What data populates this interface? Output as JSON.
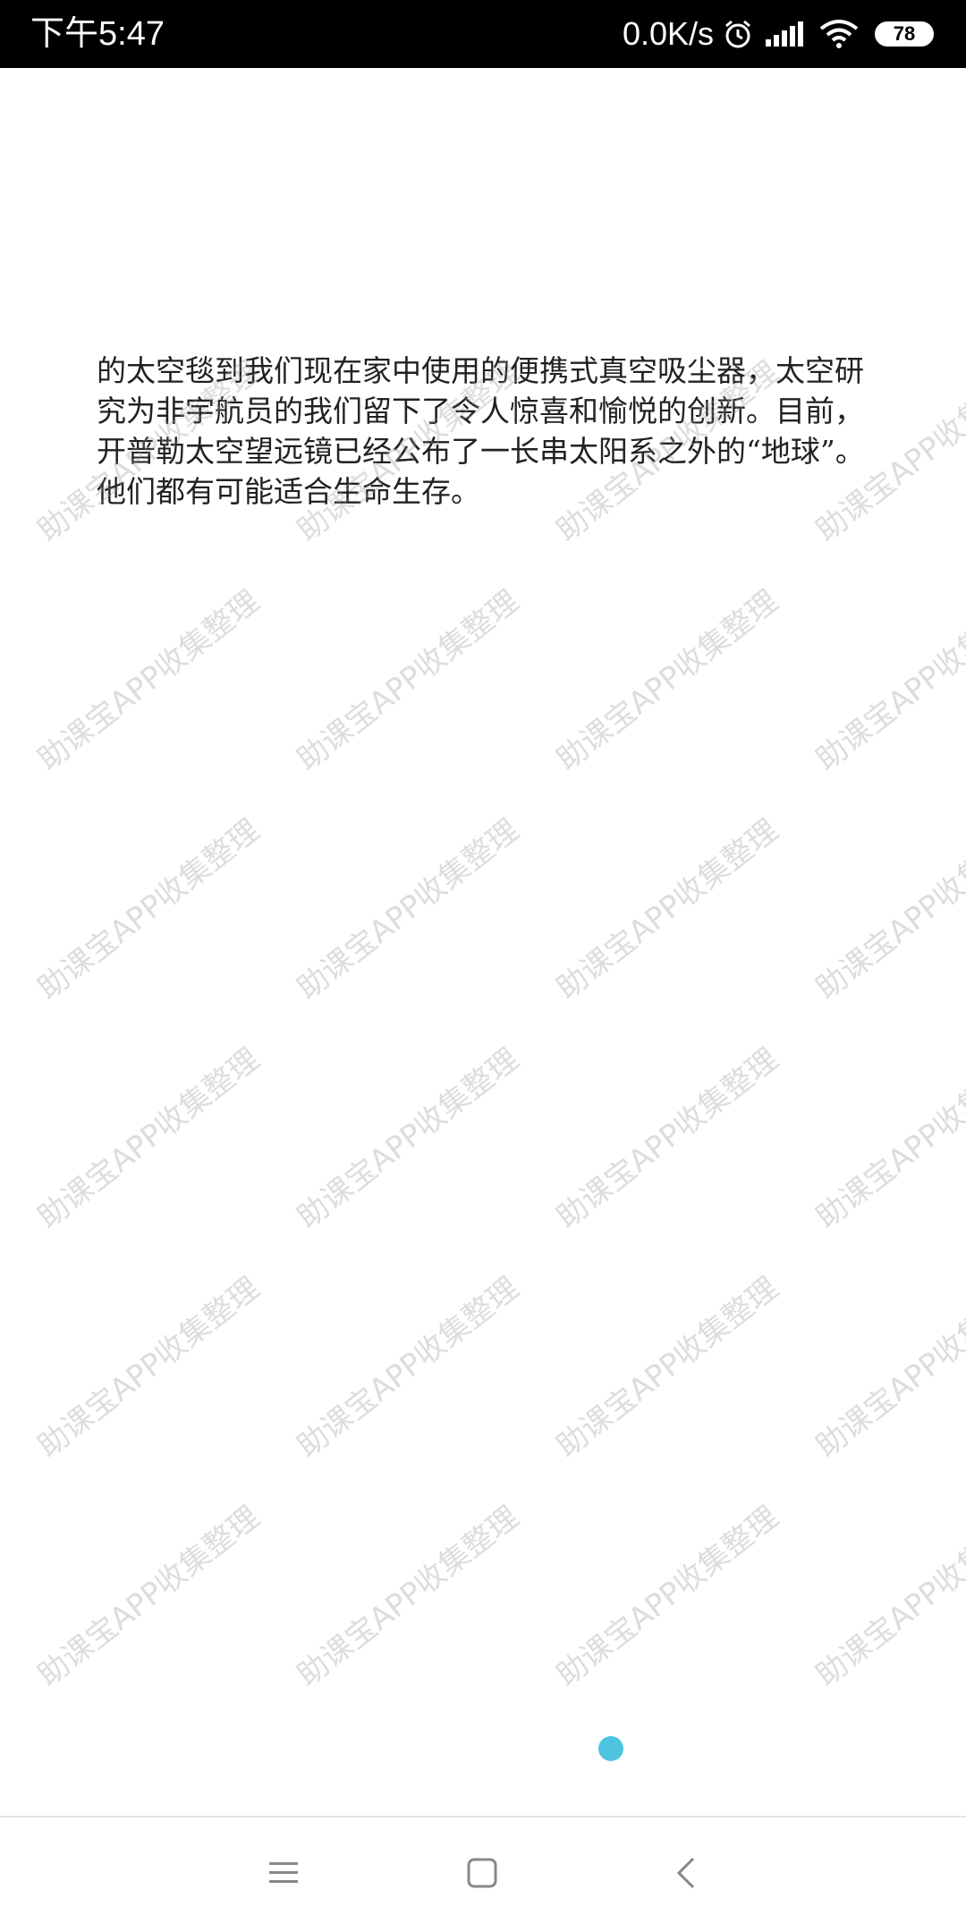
{
  "status_bar": {
    "time": "下午5:47",
    "net_speed": "0.0K/s",
    "battery": "78",
    "icons": [
      "alarm-icon",
      "signal-icon",
      "wifi-icon",
      "battery-icon"
    ]
  },
  "content": {
    "paragraph": "的太空毯到我们现在家中使用的便携式真空吸尘器，太空研究为非宇航员的我们留下了令人惊喜和愉悦的创新。目前，开普勒太空望远镜已经公布了一长串太阳系之外的“地球”。他们都有可能适合生命生存。",
    "watermark": "助课宝APP收集整理"
  },
  "pager": {
    "active_color": "#4ec3e0"
  },
  "nav_bar": {
    "icons": [
      "menu-icon",
      "home-icon",
      "back-icon"
    ]
  }
}
